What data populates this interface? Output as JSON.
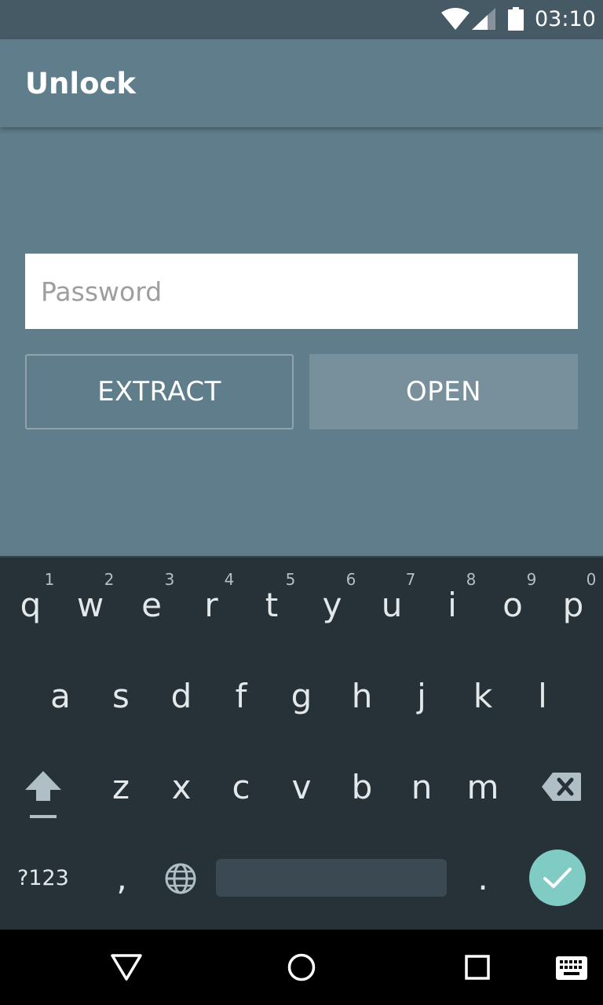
{
  "status_bar": {
    "time": "03:10",
    "icons": [
      "wifi-icon",
      "signal-icon",
      "battery-icon"
    ]
  },
  "app_bar": {
    "title": "Unlock"
  },
  "form": {
    "password_placeholder": "Password",
    "extract_label": "EXTRACT",
    "open_label": "OPEN"
  },
  "keyboard": {
    "row1": [
      "q",
      "w",
      "e",
      "r",
      "t",
      "y",
      "u",
      "i",
      "o",
      "p"
    ],
    "row1_hints": [
      "1",
      "2",
      "3",
      "4",
      "5",
      "6",
      "7",
      "8",
      "9",
      "0"
    ],
    "row2": [
      "a",
      "s",
      "d",
      "f",
      "g",
      "h",
      "j",
      "k",
      "l"
    ],
    "row3": [
      "z",
      "x",
      "c",
      "v",
      "b",
      "n",
      "m"
    ],
    "symbols_label": "?123",
    "comma": ",",
    "period": ".",
    "icons": [
      "shift-icon",
      "backspace-icon",
      "globe-icon",
      "checkmark-icon"
    ]
  },
  "nav_bar": {
    "icons": [
      "back-icon",
      "home-icon",
      "recents-icon",
      "keyboard-icon"
    ]
  },
  "colors": {
    "primary": "#607d8b",
    "status_bar": "#455a64",
    "open_button": "#78909c",
    "keyboard_bg": "#263238",
    "done_key": "#80cbc4"
  }
}
